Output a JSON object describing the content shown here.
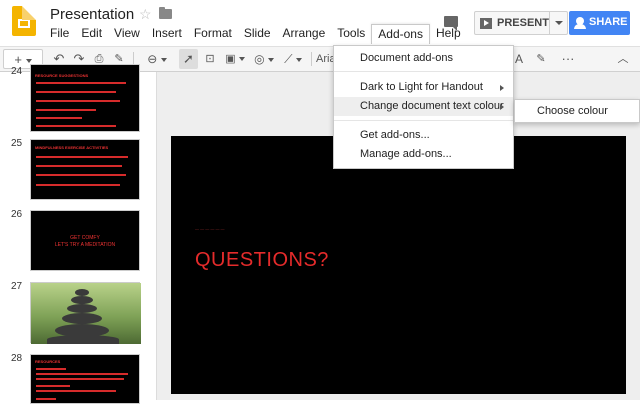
{
  "app": {
    "title": "Presentation"
  },
  "menubar": [
    "File",
    "Edit",
    "View",
    "Insert",
    "Format",
    "Slide",
    "Arrange",
    "Tools",
    "Add-ons",
    "Help"
  ],
  "header": {
    "present_label": "PRESENT",
    "share_label": "SHARE"
  },
  "toolbar": {
    "font_partial": "Aria",
    "text_color_partial": "A"
  },
  "slides": [
    {
      "number": "24",
      "title": "RESOURCE SUGGESTIONS"
    },
    {
      "number": "25",
      "title": "MINDFULNESS EXERCISE ACTIVITIES"
    },
    {
      "number": "26",
      "line1": "GET COMFY",
      "line2": "LET'S TRY A MEDITATION"
    },
    {
      "number": "27"
    },
    {
      "number": "28",
      "title": "RESOURCES"
    }
  ],
  "current_slide": {
    "heading": "QUESTIONS?"
  },
  "addons_menu": {
    "items": [
      "Document add-ons",
      "Dark to Light for Handout",
      "Change document text colour",
      "Get add-ons...",
      "Manage add-ons..."
    ],
    "highlighted_index": 2
  },
  "submenu": {
    "items": [
      "Choose colour"
    ]
  },
  "colors": {
    "accent": "#4285f4",
    "slide_bg": "#000000",
    "slide_text": "#e52b2b",
    "logo": "#f4b400"
  }
}
